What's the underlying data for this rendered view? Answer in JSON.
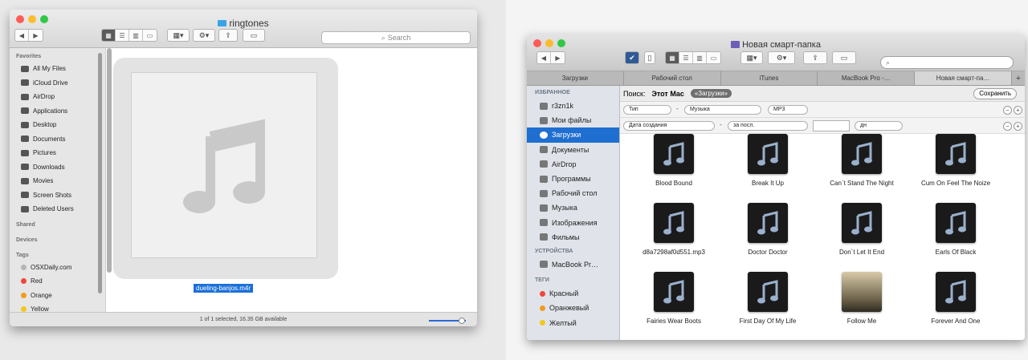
{
  "left_window": {
    "title": "ringtones",
    "search_placeholder": "Search",
    "sidebar": {
      "favorites_header": "Favorites",
      "favorites": [
        {
          "label": "All My Files",
          "icon": "all-files-icon"
        },
        {
          "label": "iCloud Drive",
          "icon": "cloud-icon"
        },
        {
          "label": "AirDrop",
          "icon": "airdrop-icon"
        },
        {
          "label": "Applications",
          "icon": "applications-icon"
        },
        {
          "label": "Desktop",
          "icon": "desktop-icon"
        },
        {
          "label": "Documents",
          "icon": "documents-icon"
        },
        {
          "label": "Pictures",
          "icon": "pictures-icon"
        },
        {
          "label": "Downloads",
          "icon": "downloads-icon"
        },
        {
          "label": "Movies",
          "icon": "movies-icon"
        },
        {
          "label": "Screen Shots",
          "icon": "gear-icon"
        },
        {
          "label": "Deleted Users",
          "icon": "folder-icon"
        }
      ],
      "shared_header": "Shared",
      "devices_header": "Devices",
      "tags_header": "Tags",
      "tags": [
        {
          "label": "OSXDaily.com",
          "color": "#b5b5b5"
        },
        {
          "label": "Red",
          "color": "#f0463c"
        },
        {
          "label": "Orange",
          "color": "#f39a1e"
        },
        {
          "label": "Yellow",
          "color": "#f2c81a"
        }
      ]
    },
    "selected_file": "dueling-banjos.m4r",
    "status": "1 of 1 selected, 16.35 GB available",
    "zoom_level": 0.9
  },
  "right_window": {
    "title": "Новая смарт-папка",
    "tabs": [
      "Загрузки",
      "Рабочий стол",
      "iTunes",
      "MacBook Pro -…",
      "Новая смарт-па…"
    ],
    "active_tab": 4,
    "sidebar": {
      "favorites_header": "ИЗБРАННОЕ",
      "favorites": [
        {
          "label": "r3zn1k",
          "icon": "home-icon"
        },
        {
          "label": "Мои файлы",
          "icon": "all-files-icon"
        },
        {
          "label": "Загрузки",
          "icon": "downloads-icon"
        },
        {
          "label": "Документы",
          "icon": "documents-icon"
        },
        {
          "label": "AirDrop",
          "icon": "airdrop-icon"
        },
        {
          "label": "Программы",
          "icon": "applications-icon"
        },
        {
          "label": "Рабочий стол",
          "icon": "desktop-icon"
        },
        {
          "label": "Музыка",
          "icon": "music-icon"
        },
        {
          "label": "Изображения",
          "icon": "camera-icon"
        },
        {
          "label": "Фильмы",
          "icon": "movies-icon"
        }
      ],
      "selected_index": 2,
      "devices_header": "УСТРОЙСТВА",
      "devices": [
        {
          "label": "MacBook Pr…",
          "icon": "laptop-icon"
        }
      ],
      "tags_header": "ТЕГИ",
      "tags": [
        {
          "label": "Красный",
          "color": "#f0463c"
        },
        {
          "label": "Оранжевый",
          "color": "#f39a1e"
        },
        {
          "label": "Желтый",
          "color": "#f2c81a"
        }
      ]
    },
    "search_bar": {
      "label": "Поиск:",
      "scope_this_mac": "Этот Mac",
      "scope_downloads": "«Загрузки»",
      "save_button": "Сохранить"
    },
    "criteria": [
      {
        "attribute": "Тип",
        "op": "Музыка",
        "value": "MP3"
      },
      {
        "attribute": "Дата создания",
        "op": "за посл.",
        "value": "",
        "unit": "дн"
      }
    ],
    "files": [
      {
        "name": "Blood Bound",
        "art": false
      },
      {
        "name": "Break It Up",
        "art": false
      },
      {
        "name": "Can`t Stand The Night",
        "art": false
      },
      {
        "name": "Cum On Feel The Noize",
        "art": false
      },
      {
        "name": "d8a7298af0d551.mp3",
        "art": false
      },
      {
        "name": "Doctor Doctor",
        "art": false
      },
      {
        "name": "Don`t Let It End",
        "art": false
      },
      {
        "name": "Earls Of Black",
        "art": false
      },
      {
        "name": "Fairies Wear Boots",
        "art": false
      },
      {
        "name": "First Day Of My Life",
        "art": false
      },
      {
        "name": "Follow Me",
        "art": true
      },
      {
        "name": "Forever And One",
        "art": false
      }
    ]
  }
}
